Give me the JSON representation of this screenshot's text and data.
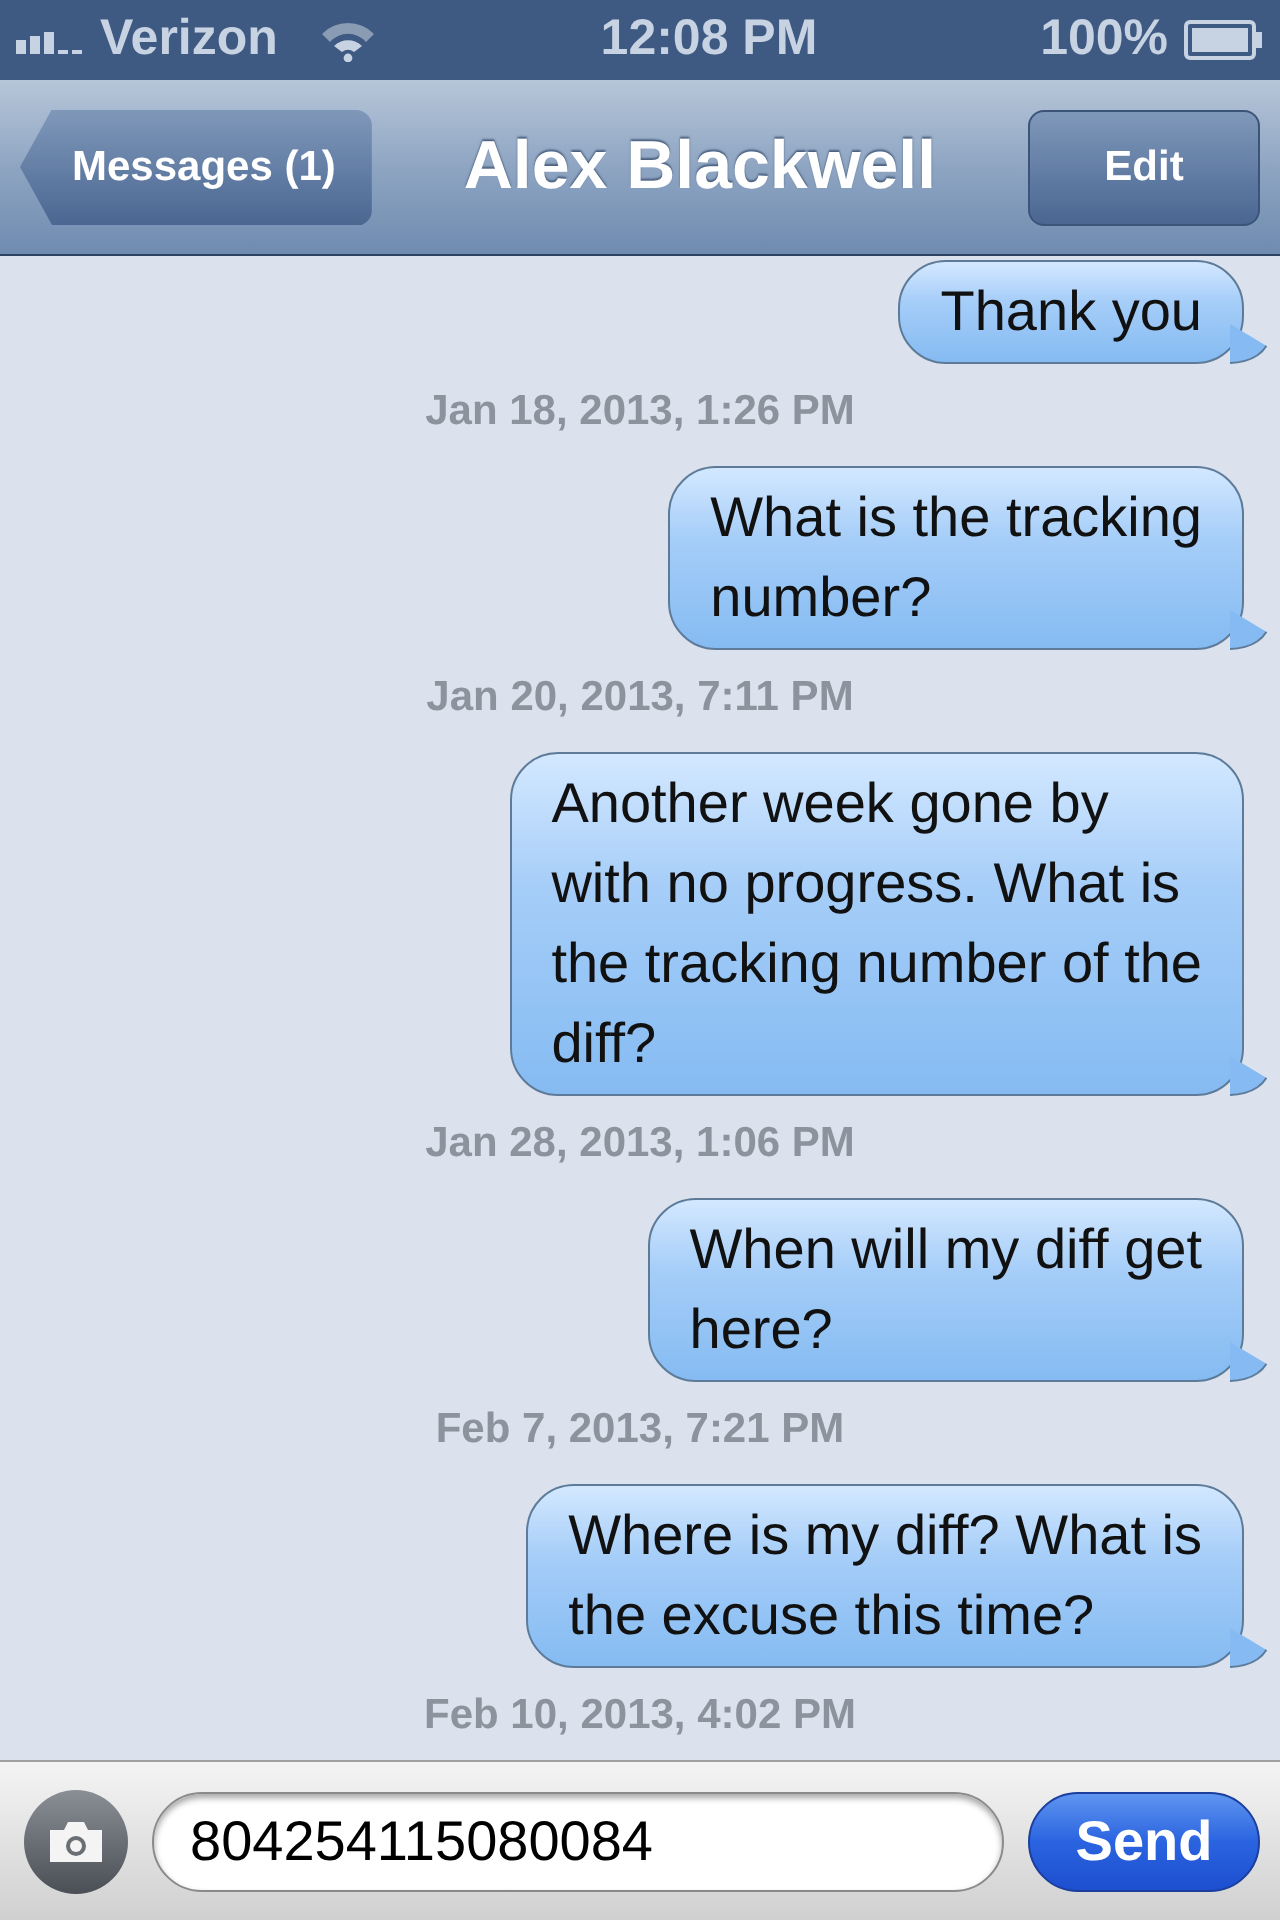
{
  "status_bar": {
    "carrier": "Verizon",
    "time": "12:08 PM",
    "battery": "100%"
  },
  "nav": {
    "back": "Messages (1)",
    "title": "Alex Blackwell",
    "action": "Edit"
  },
  "thread": [
    {
      "kind": "message",
      "text": "Thank you"
    },
    {
      "kind": "timestamp",
      "text": "Jan 18, 2013, 1:26 PM"
    },
    {
      "kind": "message",
      "text": "What is the tracking\nnumber?"
    },
    {
      "kind": "timestamp",
      "text": "Jan 20, 2013, 7:11 PM"
    },
    {
      "kind": "message",
      "text": "Another week gone by\nwith no progress. What is\nthe tracking number of the\ndiff?"
    },
    {
      "kind": "timestamp",
      "text": "Jan 28, 2013, 1:06 PM"
    },
    {
      "kind": "message",
      "text": "When will my diff get\nhere?"
    },
    {
      "kind": "timestamp",
      "text": "Feb 7, 2013, 7:21 PM"
    },
    {
      "kind": "message",
      "text": "Where is my diff? What is\nthe excuse this time?"
    },
    {
      "kind": "timestamp",
      "text": "Feb 10, 2013, 4:02 PM"
    }
  ],
  "composer": {
    "value": "804254115080084",
    "send": "Send"
  }
}
